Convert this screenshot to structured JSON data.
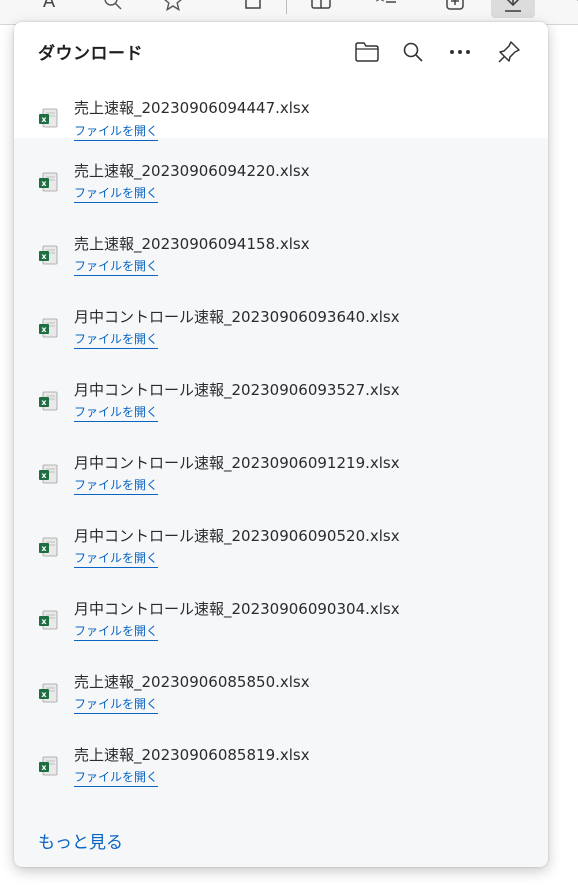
{
  "toolbar": {
    "icons": [
      "read-aloud-icon",
      "search-icon",
      "favorite-star-icon",
      "extensions-icon",
      "split-screen-icon",
      "favorites-list-icon",
      "collections-icon",
      "download-icon",
      "more-icon"
    ],
    "read_aloud_glyph": "A"
  },
  "panel": {
    "title": "ダウンロード",
    "header_actions": [
      "open-folder-icon",
      "search-icon",
      "more-options-icon",
      "pin-icon"
    ]
  },
  "downloads": [
    {
      "filename": "売上速報_20230906094447.xlsx",
      "action": "ファイルを開く",
      "icon": "excel-file-icon"
    },
    {
      "filename": "売上速報_20230906094220.xlsx",
      "action": "ファイルを開く",
      "icon": "excel-file-icon"
    },
    {
      "filename": "売上速報_20230906094158.xlsx",
      "action": "ファイルを開く",
      "icon": "excel-file-icon"
    },
    {
      "filename": "月中コントロール速報_20230906093640.xlsx",
      "action": "ファイルを開く",
      "icon": "excel-file-icon"
    },
    {
      "filename": "月中コントロール速報_20230906093527.xlsx",
      "action": "ファイルを開く",
      "icon": "excel-file-icon"
    },
    {
      "filename": "月中コントロール速報_20230906091219.xlsx",
      "action": "ファイルを開く",
      "icon": "excel-file-icon"
    },
    {
      "filename": "月中コントロール速報_20230906090520.xlsx",
      "action": "ファイルを開く",
      "icon": "excel-file-icon"
    },
    {
      "filename": "月中コントロール速報_20230906090304.xlsx",
      "action": "ファイルを開く",
      "icon": "excel-file-icon"
    },
    {
      "filename": "売上速報_20230906085850.xlsx",
      "action": "ファイルを開く",
      "icon": "excel-file-icon"
    },
    {
      "filename": "売上速報_20230906085819.xlsx",
      "action": "ファイルを開く",
      "icon": "excel-file-icon"
    }
  ],
  "footer": {
    "more_label": "もっと見る"
  },
  "colors": {
    "link": "#0a64c2",
    "excel_green": "#1d6f42",
    "panel_bg": "#f5f7f9"
  }
}
